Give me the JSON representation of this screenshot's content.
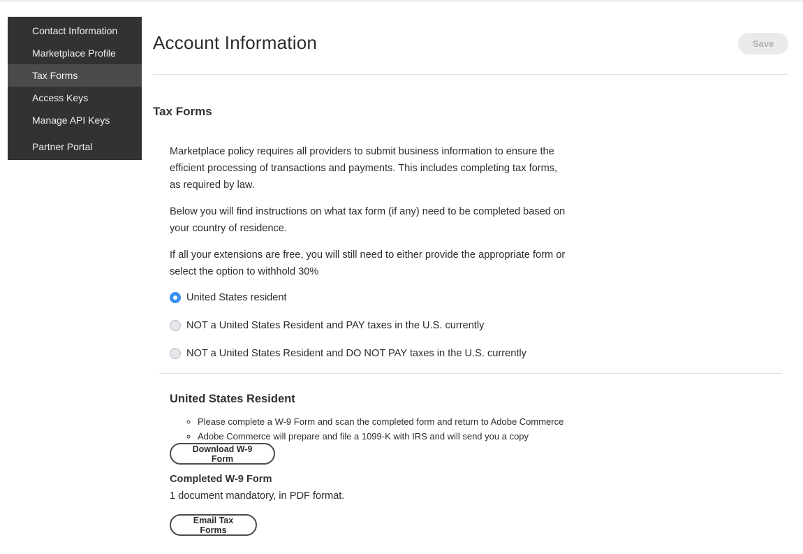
{
  "sidebar": {
    "items": [
      {
        "label": "Contact Information",
        "active": false
      },
      {
        "label": "Marketplace Profile",
        "active": false
      },
      {
        "label": "Tax Forms",
        "active": true
      },
      {
        "label": "Access Keys",
        "active": false
      },
      {
        "label": "Manage API Keys",
        "active": false
      },
      {
        "label": "Partner Portal",
        "active": false
      }
    ]
  },
  "header": {
    "title": "Account Information",
    "save_label": "Save"
  },
  "section": {
    "title": "Tax Forms",
    "paragraphs": [
      "Marketplace policy requires all providers to submit business information to ensure the efficient processing of transactions and payments. This includes completing tax forms, as required by law.",
      "Below you will find instructions on what tax form (if any) need to be completed based on your country of residence.",
      "If all your extensions are free, you will still need to either provide the appropriate form or select the option to withhold 30%"
    ],
    "residency_options": [
      {
        "label": "United States resident",
        "checked": true
      },
      {
        "label": "NOT a United States Resident and PAY taxes in the U.S. currently",
        "checked": false
      },
      {
        "label": "NOT a United States Resident and DO NOT PAY taxes in the U.S. currently",
        "checked": false
      }
    ]
  },
  "resident_details": {
    "title": "United States Resident",
    "bullets": [
      "Please complete a W-9 Form and scan the completed form and return to Adobe Commerce",
      "Adobe Commerce will prepare and file a 1099-K with IRS and will send you a copy"
    ],
    "download_label": "Download W-9 Form",
    "completed_title": "Completed W-9 Form",
    "completed_desc": "1 document mandatory, in PDF format.",
    "email_label": "Email Tax Forms"
  },
  "colors": {
    "sidebar_bg": "#323232",
    "sidebar_active": "#4b4b4b",
    "radio_selected": "#378ef0"
  }
}
